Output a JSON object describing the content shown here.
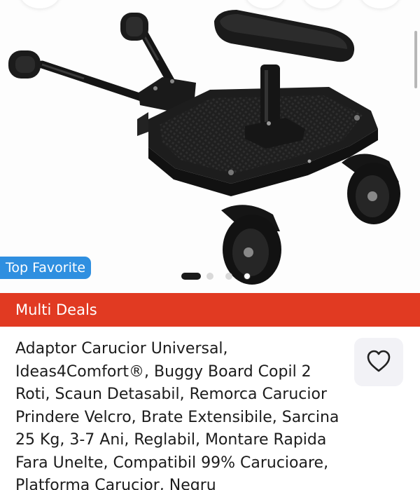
{
  "gallery": {
    "badge_label": "Top Favorite",
    "slide_count": 4,
    "active_slide": 1
  },
  "deals": {
    "label": "Multi Deals"
  },
  "product": {
    "title": "Adaptor Carucior Universal, Ideas4Comfort®, Buggy Board Copil 2 Roti, Scaun Detasabil, Remorca Carucior Prindere Velcro, Brate Extensibile, Sarcina 25 Kg, 3-7 Ani, Reglabil, Montare Rapida Fara Unelte, Compatibil 99% Carucioare, Platforma Carucior, Negru"
  },
  "favorite": {
    "icon": "heart-icon"
  },
  "colors": {
    "badge_blue": "#2f8fe0",
    "deals_red": "#e13a22",
    "text": "#1c1c1c"
  }
}
